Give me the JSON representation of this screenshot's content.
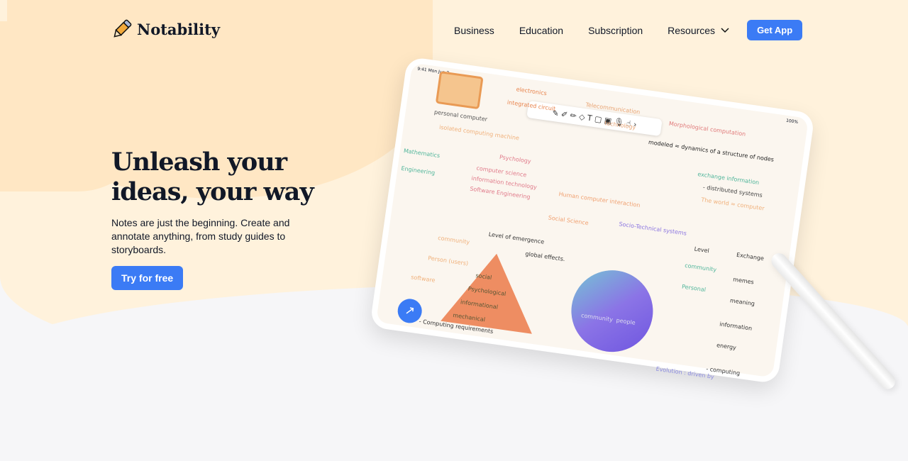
{
  "brand": {
    "name": "Notability",
    "icon": "pencil-icon"
  },
  "nav": {
    "items": [
      "Business",
      "Education",
      "Subscription",
      "Resources"
    ],
    "cta": "Get App"
  },
  "hero": {
    "title": "Unleash your ideas, your way",
    "subtitle": "Notes are just the beginning. Create and annotate anything, from study guides to storyboards.",
    "button": "Try for free"
  },
  "colors": {
    "accent": "#3b7bf5",
    "cream": "#fff2dc",
    "blob": "#ffe7c4",
    "gray": "#f6f6f8"
  },
  "tablet": {
    "time": "9:41 Mon Jun 3",
    "battery": "100%",
    "notes": [
      {
        "t": "electronics",
        "c": "#e8834c"
      },
      {
        "t": "Telecommunication",
        "c": "#e8a474"
      },
      {
        "t": "integrated circuit",
        "c": "#e8834c"
      },
      {
        "t": "technology",
        "c": "#e8a474"
      },
      {
        "t": "Morphological computation",
        "c": "#e07a7a"
      },
      {
        "t": "personal computer",
        "c": "#555"
      },
      {
        "t": "isolated computing machine",
        "c": "#f0b07a"
      },
      {
        "t": "modeled ≈ dynamics of a structure of nodes",
        "c": "#222"
      },
      {
        "t": "exchange information",
        "c": "#4fb59a"
      },
      {
        "t": "- distributed systems",
        "c": "#444"
      },
      {
        "t": "The world ≈ computer",
        "c": "#f0b07a"
      },
      {
        "t": "Psychology",
        "c": "#e07a8a"
      },
      {
        "t": "Mathematics",
        "c": "#4fb59a"
      },
      {
        "t": "Engineering",
        "c": "#4fb59a"
      },
      {
        "t": "computer science",
        "c": "#e07a8a"
      },
      {
        "t": "information technology",
        "c": "#e07a8a"
      },
      {
        "t": "Software Engineering",
        "c": "#e07a8a"
      },
      {
        "t": "Human computer interaction",
        "c": "#f0a070"
      },
      {
        "t": "Social Science",
        "c": "#f0a070"
      },
      {
        "t": "Socio-Technical systems",
        "c": "#8a74e0"
      },
      {
        "t": "Level of emergence",
        "c": "#333"
      },
      {
        "t": "community",
        "c": "#f0b07a"
      },
      {
        "t": "Person (users)",
        "c": "#f0b07a"
      },
      {
        "t": "software",
        "c": "#f0b07a"
      },
      {
        "t": "global effects.",
        "c": "#333"
      },
      {
        "t": "Level",
        "c": "#333"
      },
      {
        "t": "Exchange",
        "c": "#333"
      },
      {
        "t": "community",
        "c": "#4fb59a"
      },
      {
        "t": "Personal",
        "c": "#4fb59a"
      },
      {
        "t": "memes",
        "c": "#333"
      },
      {
        "t": "meaning",
        "c": "#333"
      },
      {
        "t": "information",
        "c": "#333"
      },
      {
        "t": "energy",
        "c": "#333"
      },
      {
        "t": "- Computing requirements",
        "c": "#333"
      },
      {
        "t": "Evolution : driven by",
        "c": "#8a8ae0"
      },
      {
        "t": "- computing",
        "c": "#333"
      }
    ],
    "pyramid": [
      "social",
      "Psychological",
      "informational",
      "mechanical"
    ],
    "globe": [
      "community",
      "people"
    ]
  }
}
